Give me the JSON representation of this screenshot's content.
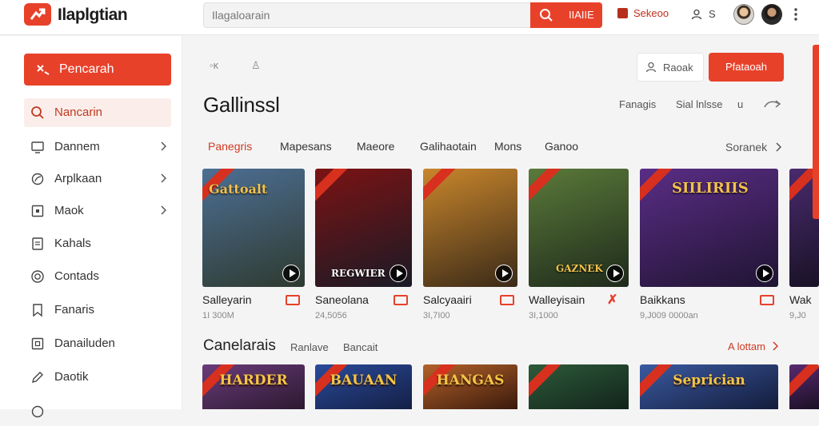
{
  "header": {
    "app_title": "Ilaplgtian",
    "search_placeholder": "Ilagaloarain",
    "search_button": "IIAIIE",
    "brand_link": "Sekeoo",
    "user_link": "S"
  },
  "sidebar": {
    "cta_label": "Pencarah",
    "items": [
      {
        "label": "Nancarin",
        "icon": "search-icon",
        "active": true
      },
      {
        "label": "Dannem",
        "icon": "monitor-icon"
      },
      {
        "label": "Arplkaan",
        "icon": "leaf-icon"
      },
      {
        "label": "Maok",
        "icon": "square-icon"
      },
      {
        "label": "Kahals",
        "icon": "document-icon"
      },
      {
        "label": "Contads",
        "icon": "circle-icon"
      },
      {
        "label": "Fanaris",
        "icon": "bookmark-icon"
      },
      {
        "label": "Danailuden",
        "icon": "book-icon"
      },
      {
        "label": "Daotik",
        "icon": "pencil-icon"
      }
    ]
  },
  "toolbar": {
    "outline_button": "Raoak",
    "primary_button": "Pfataoah",
    "icon_left": "◦ĸ",
    "icon_right": "♙"
  },
  "main": {
    "page_title": "Gallinssl",
    "links": [
      "Fanagis",
      "Sial lnlsse",
      "u"
    ],
    "tabs": [
      "Panegris",
      "Mapesans",
      "Maeore",
      "Galihaotain",
      "Mons",
      "Ganoo"
    ],
    "active_tab": 0,
    "tabs_more": "Soranek"
  },
  "games": [
    {
      "name": "Salleyarin",
      "meta": "1I 300M",
      "overlay_title": "Gattoalt",
      "overlay_bottom": "",
      "colors": [
        "#4d6f95",
        "#2e3a2f"
      ]
    },
    {
      "name": "Saneolana",
      "meta": "24,5056",
      "overlay_title": "",
      "overlay_bottom": "REGWIER",
      "colors": [
        "#7b1313",
        "#1a1a26"
      ]
    },
    {
      "name": "Salcyaairi",
      "meta": "3I,7I00",
      "overlay_title": "",
      "overlay_bottom": "",
      "colors": [
        "#c9862c",
        "#3a2a18"
      ]
    },
    {
      "name": "Walleyisain",
      "meta": "3I,1000",
      "overlay_title": "",
      "overlay_bottom": "GAZNEK",
      "colors": [
        "#5b7a3a",
        "#1e2a1b"
      ]
    },
    {
      "name": "Baikkans",
      "meta": "9,J009 0000an",
      "overlay_title": "SIILIRIIS",
      "overlay_bottom": "",
      "colors": [
        "#5a2d86",
        "#201432"
      ]
    },
    {
      "name": "Wak",
      "meta": "9,J0",
      "overlay_title": "",
      "overlay_bottom": "",
      "colors": [
        "#4a2a6e",
        "#191226"
      ]
    }
  ],
  "section2": {
    "title": "Canelarais",
    "links": [
      "Ranlave",
      "Bancait"
    ],
    "all_link": "A lottam",
    "cards": [
      {
        "title": "HARDER",
        "colors": [
          "#6a3b7a",
          "#2c1930"
        ]
      },
      {
        "title": "BAUAAN",
        "colors": [
          "#2a4a9a",
          "#142046"
        ]
      },
      {
        "title": "HANGAS",
        "colors": [
          "#b4622a",
          "#3a1a0c"
        ]
      },
      {
        "title": "",
        "colors": [
          "#2d5a3a",
          "#12241a"
        ]
      },
      {
        "title": "Seprician",
        "colors": [
          "#3a5aa0",
          "#141c3c"
        ]
      },
      {
        "title": "",
        "colors": [
          "#5a2a70",
          "#1a0f24"
        ]
      }
    ]
  },
  "colors": {
    "accent": "#e8412a",
    "accent_dark": "#c23820",
    "background": "#f4f4f5"
  }
}
